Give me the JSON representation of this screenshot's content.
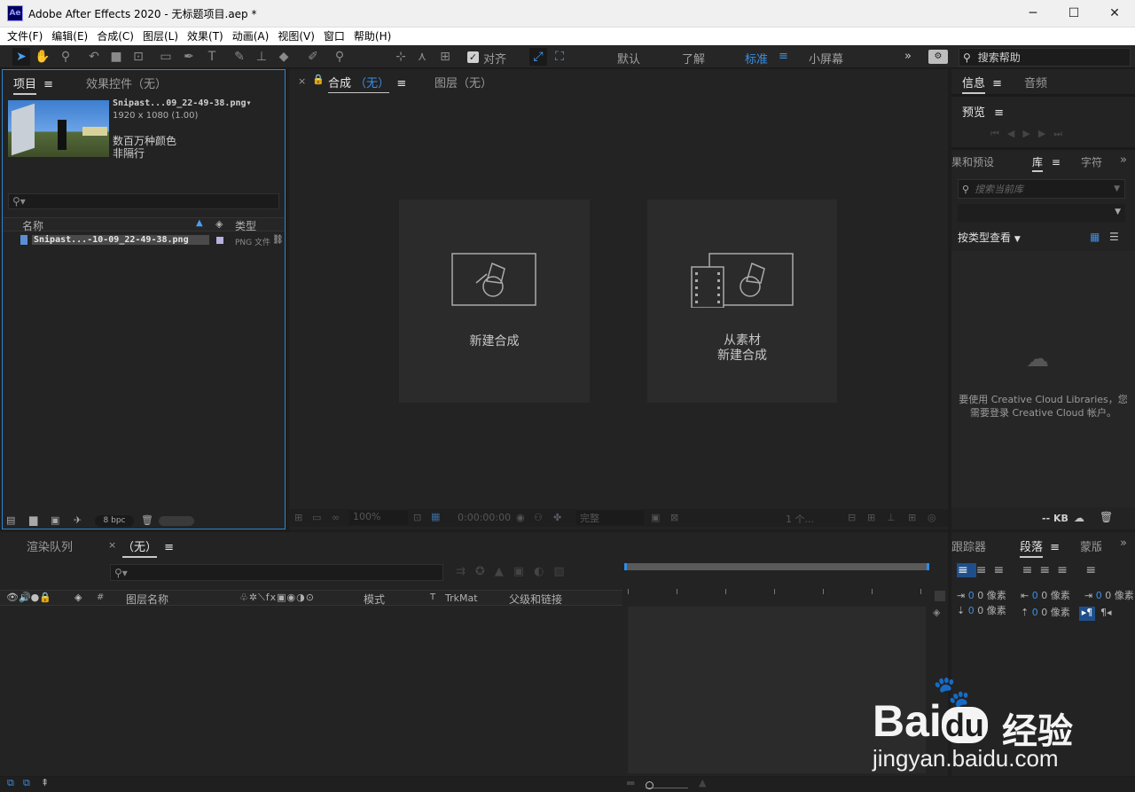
{
  "window": {
    "title": "Adobe After Effects 2020 - 无标题项目.aep *",
    "app_icon": "Ae",
    "controls": [
      "─",
      "☐",
      "✕"
    ]
  },
  "menu": [
    "文件(F)",
    "编辑(E)",
    "合成(C)",
    "图层(L)",
    "效果(T)",
    "动画(A)",
    "视图(V)",
    "窗口",
    "帮助(H)"
  ],
  "toolbar": {
    "snap_label": "对齐",
    "workspaces": [
      "默认",
      "了解",
      "标准",
      "小屏幕"
    ],
    "active_workspace": "标准",
    "search_placeholder": "搜索帮助"
  },
  "project_panel": {
    "tab_project": "项目",
    "tab_effects": "效果控件（无）",
    "file": {
      "name": "Snipast...09_22-49-38.png▾",
      "dims": "1920 x 1080 (1.00)",
      "colors": "数百万种颜色",
      "interlace": "非隔行"
    },
    "col_name": "名称",
    "col_type": "类型",
    "item": {
      "name": "Snipast...-10-09_22-49-38.png",
      "type": "PNG 文件"
    },
    "bpc": "8 bpc"
  },
  "comp_panel": {
    "tab_comp": "合成",
    "tab_comp_none": "（无）",
    "tab_layer": "图层（无）",
    "new_comp": "新建合成",
    "from_footage_1": "从素材",
    "from_footage_2": "新建合成",
    "zoom": "100%",
    "timecode": "0:00:00:00",
    "quality": "完整",
    "views": "1 个..."
  },
  "right_panel": {
    "tab_info": "信息",
    "tab_audio": "音频",
    "preview": "预览",
    "tab_effects_presets": "果和预设",
    "tab_library": "库",
    "tab_char": "字符",
    "lib_search": "搜索当前库",
    "view_by_type": "按类型查看",
    "cc_msg_1": "要使用 Creative Cloud Libraries，您",
    "cc_msg_2": "需要登录 Creative Cloud 帐户。",
    "kb": "-- KB"
  },
  "timeline": {
    "tab_render": "渲染队列",
    "tab_none": "（无）",
    "col_hash": "#",
    "col_layer_name": "图层名称",
    "col_mode": "模式",
    "col_t": "T",
    "col_trkmat": "TrkMat",
    "col_parent": "父级和链接"
  },
  "paragraph_panel": {
    "tab_tracker": "跟踪器",
    "tab_paragraph": "段落",
    "tab_mask": "蒙版",
    "px_values": [
      "0 像素",
      "0 像素",
      "0 像素",
      "0 像素",
      "0 像素"
    ]
  },
  "watermark": {
    "brand": "Bai",
    "brand2": "du",
    "suffix": "经验",
    "url": "jingyan.baidu.com"
  },
  "colors": {
    "accent": "#2d8ceb",
    "panel_bg": "#232323",
    "active_border": "#2b86d4"
  }
}
